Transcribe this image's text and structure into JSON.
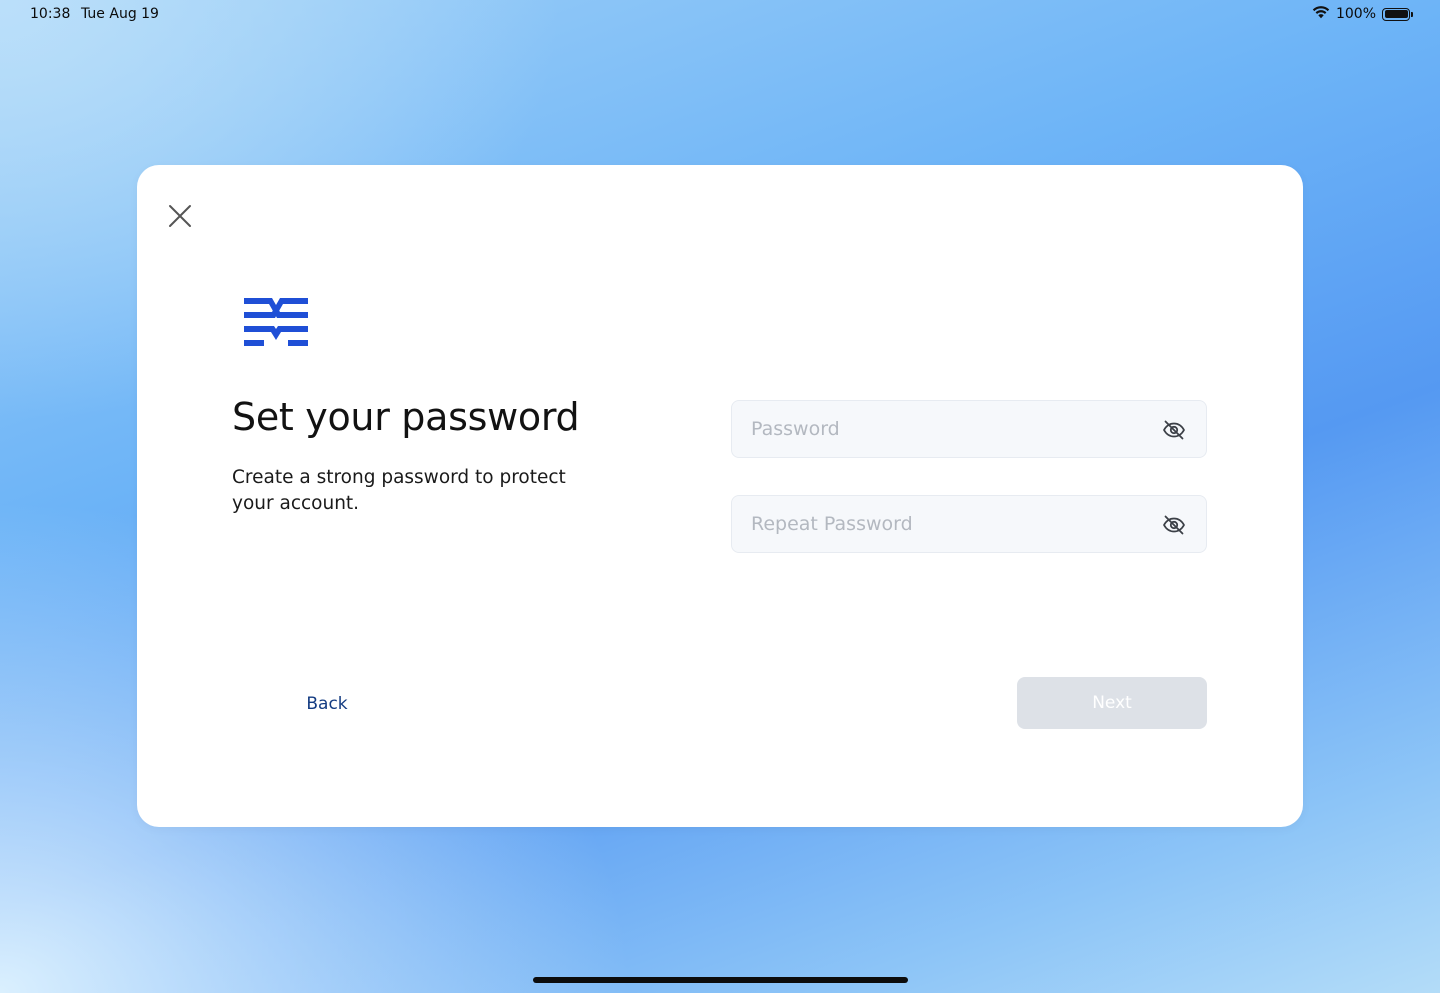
{
  "status_bar": {
    "time": "10:38",
    "date": "Tue Aug 19",
    "battery": "100%",
    "wifi_icon": "wifi-icon",
    "battery_icon": "battery-icon"
  },
  "dialog": {
    "close_icon": "close-icon",
    "logo": "brand-logo",
    "brand_color": "#1f4fd6",
    "title": "Set your password",
    "subtitle": "Create a strong password to protect your account.",
    "fields": [
      {
        "placeholder": "Password",
        "value": "",
        "toggle_icon": "eye-off-icon"
      },
      {
        "placeholder": "Repeat Password",
        "value": "",
        "toggle_icon": "eye-off-icon"
      }
    ],
    "back_label": "Back",
    "next_label": "Next",
    "next_disabled": true
  }
}
